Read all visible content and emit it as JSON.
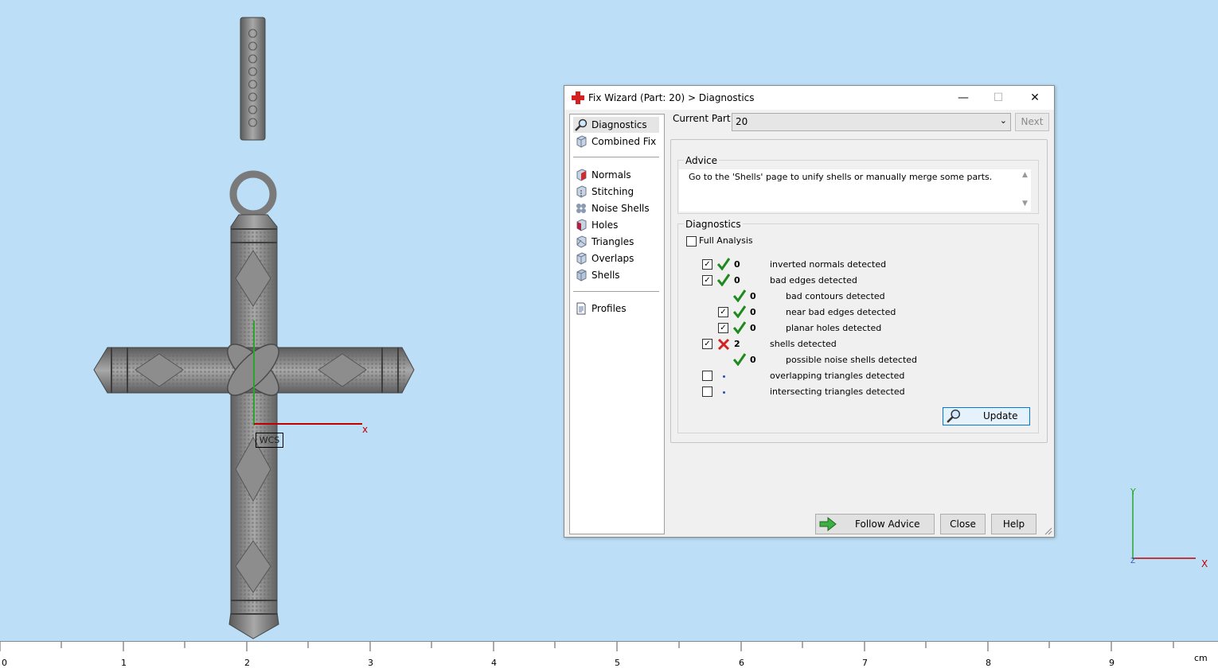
{
  "viewport": {
    "wcs_label": "WCS",
    "axis_x_label": "x",
    "tripod": {
      "x_label": "X",
      "y_label": "Y",
      "z_label": "Z"
    }
  },
  "ruler": {
    "numbers": [
      "0",
      "1",
      "2",
      "3",
      "4",
      "5",
      "6",
      "7",
      "8",
      "9"
    ],
    "unit": "cm"
  },
  "dialog": {
    "title": "Fix Wizard (Part: 20) > Diagnostics",
    "icon": "red-cross-icon",
    "window_buttons": {
      "minimize": "—",
      "maximize": "☐",
      "close": "✕"
    },
    "nav": {
      "items": [
        {
          "label": "Diagnostics",
          "icon": "magnifier-icon",
          "selected": true
        },
        {
          "label": "Combined Fix",
          "icon": "cube-icon"
        },
        {
          "label": "Normals",
          "icon": "normals-cube-icon"
        },
        {
          "label": "Stitching",
          "icon": "stitching-cube-icon"
        },
        {
          "label": "Noise Shells",
          "icon": "noise-shells-icon"
        },
        {
          "label": "Holes",
          "icon": "holes-cube-icon"
        },
        {
          "label": "Triangles",
          "icon": "triangles-cube-icon"
        },
        {
          "label": "Overlaps",
          "icon": "overlaps-cube-icon"
        },
        {
          "label": "Shells",
          "icon": "shells-cube-icon"
        },
        {
          "label": "Profiles",
          "icon": "document-icon"
        }
      ]
    },
    "current_part_label": "Current Part:",
    "current_part_value": "20",
    "next_button": "Next",
    "advice": {
      "title": "Advice",
      "text": "Go to the 'Shells' page to unify shells or manually merge some parts."
    },
    "diagnostics": {
      "title": "Diagnostics",
      "full_analysis_label": "Full Analysis",
      "full_analysis_checked": false,
      "rows": [
        {
          "checked": true,
          "status": "ok",
          "count": "0",
          "label": "inverted normals detected",
          "indent": 0
        },
        {
          "checked": true,
          "status": "ok",
          "count": "0",
          "label": "bad edges detected",
          "indent": 0
        },
        {
          "checked": null,
          "status": "ok",
          "count": "0",
          "label": "bad contours detected",
          "indent": 1
        },
        {
          "checked": true,
          "status": "ok",
          "count": "0",
          "label": "near bad edges detected",
          "indent": 1
        },
        {
          "checked": true,
          "status": "ok",
          "count": "0",
          "label": "planar holes detected",
          "indent": 1
        },
        {
          "checked": true,
          "status": "error",
          "count": "2",
          "label": "shells detected",
          "indent": 0
        },
        {
          "checked": null,
          "status": "ok",
          "count": "0",
          "label": "possible noise shells detected",
          "indent": 1
        },
        {
          "checked": false,
          "status": "unknown",
          "count": "",
          "label": "overlapping triangles detected",
          "indent": 0
        },
        {
          "checked": false,
          "status": "unknown",
          "count": "",
          "label": "intersecting triangles detected",
          "indent": 0
        }
      ],
      "update_button": "Update"
    },
    "footer": {
      "follow_advice": "Follow Advice",
      "close": "Close",
      "help": "Help"
    },
    "colors": {
      "ok": "#1e8a1e",
      "error": "#d42020",
      "accent": "#0078d7"
    }
  }
}
